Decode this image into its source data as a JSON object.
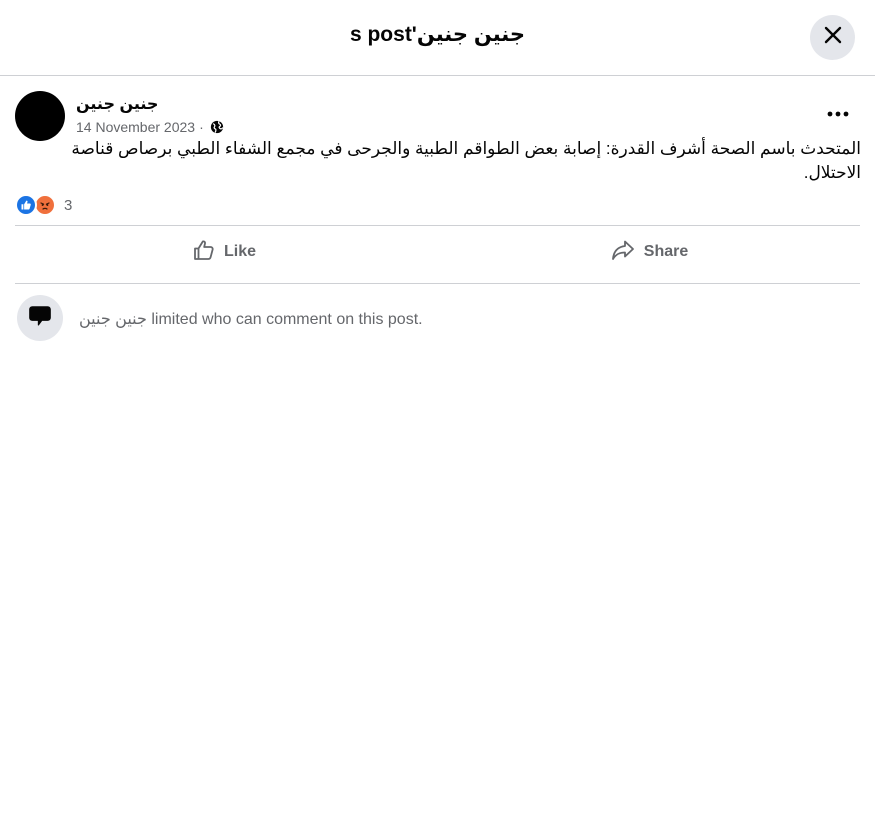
{
  "header": {
    "title": "s post'جنين جنين"
  },
  "post": {
    "author": "جنين جنين",
    "date": "14 November 2023",
    "separator": "·",
    "audience_icon": "globe-icon",
    "text": "المتحدث باسم الصحة أشرف القدرة: إصابة بعض الطواقم الطبية والجرحى في مجمع الشفاء الطبي برصاص قناصة الاحتلال.",
    "reactions": {
      "types": [
        "like",
        "angry"
      ],
      "count": "3"
    }
  },
  "actions": {
    "like_label": "Like",
    "share_label": "Share"
  },
  "comment_notice": {
    "name": "جنين جنين",
    "text": " limited who can comment on this post."
  },
  "colors": {
    "like_blue": "#1b74e4",
    "angry_orange": "#f0703c",
    "muted_text": "#65676b",
    "button_bg": "#e4e6eb"
  }
}
